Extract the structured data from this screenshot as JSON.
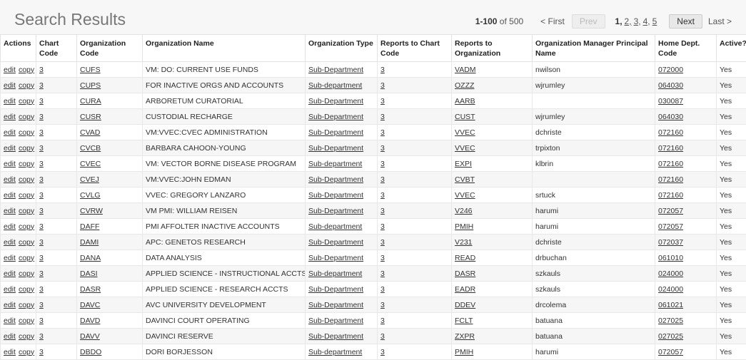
{
  "page": {
    "title": "Search Results"
  },
  "pager": {
    "range": "1-100",
    "of_total": "of 500",
    "first": "< First",
    "prev": "Prev",
    "current_page": "1,",
    "pages": [
      "2,",
      "3,",
      "4,",
      "5"
    ],
    "next": "Next",
    "last": "Last >"
  },
  "table": {
    "headers": {
      "actions": "Actions",
      "chart_code": "Chart Code",
      "org_code": "Organization Code",
      "org_name": "Organization Name",
      "org_type": "Organization Type",
      "reports_chart": "Reports to Chart Code",
      "reports_org": "Reports to Organization",
      "manager": "Organization Manager Principal Name",
      "home_dept": "Home Dept. Code",
      "active": "Active?"
    },
    "action_labels": {
      "edit": "edit",
      "copy": "copy"
    },
    "rows": [
      {
        "chart": "3",
        "code": "CUFS",
        "name": "VM: DO: CURRENT USE FUNDS",
        "type": "Sub-Department",
        "rchart": "3",
        "rorg": "VADM",
        "mgr": "nwilson",
        "dept": "072000",
        "active": "Yes"
      },
      {
        "chart": "3",
        "code": "CUPS",
        "name": "FOR INACTIVE ORGS AND ACCOUNTS",
        "type": "Sub-department",
        "rchart": "3",
        "rorg": "OZZZ",
        "mgr": "wjrumley",
        "dept": "064030",
        "active": "Yes"
      },
      {
        "chart": "3",
        "code": "CURA",
        "name": "ARBORETUM CURATORIAL",
        "type": "Sub-Department",
        "rchart": "3",
        "rorg": "AARB",
        "mgr": "",
        "dept": "030087",
        "active": "Yes"
      },
      {
        "chart": "3",
        "code": "CUSR",
        "name": "CUSTODIAL RECHARGE",
        "type": "Sub-Department",
        "rchart": "3",
        "rorg": "CUST",
        "mgr": "wjrumley",
        "dept": "064030",
        "active": "Yes"
      },
      {
        "chart": "3",
        "code": "CVAD",
        "name": "VM:VVEC:CVEC ADMINISTRATION",
        "type": "Sub-Department",
        "rchart": "3",
        "rorg": "VVEC",
        "mgr": "dchriste",
        "dept": "072160",
        "active": "Yes"
      },
      {
        "chart": "3",
        "code": "CVCB",
        "name": "BARBARA CAHOON-YOUNG",
        "type": "Sub-Department",
        "rchart": "3",
        "rorg": "VVEC",
        "mgr": "trpixton",
        "dept": "072160",
        "active": "Yes"
      },
      {
        "chart": "3",
        "code": "CVEC",
        "name": "VM: VECTOR BORNE DISEASE PROGRAM",
        "type": "Sub-department",
        "rchart": "3",
        "rorg": "EXPI",
        "mgr": "klbrin",
        "dept": "072160",
        "active": "Yes"
      },
      {
        "chart": "3",
        "code": "CVEJ",
        "name": "VM:VVEC:JOHN EDMAN",
        "type": "Sub-Department",
        "rchart": "3",
        "rorg": "CVBT",
        "mgr": "",
        "dept": "072160",
        "active": "Yes"
      },
      {
        "chart": "3",
        "code": "CVLG",
        "name": "VVEC: GREGORY LANZARO",
        "type": "Sub-Department",
        "rchart": "3",
        "rorg": "VVEC",
        "mgr": "srtuck",
        "dept": "072160",
        "active": "Yes"
      },
      {
        "chart": "3",
        "code": "CVRW",
        "name": "VM PMI: WILLIAM REISEN",
        "type": "Sub-Department",
        "rchart": "3",
        "rorg": "V246",
        "mgr": "harumi",
        "dept": "072057",
        "active": "Yes"
      },
      {
        "chart": "3",
        "code": "DAFF",
        "name": "PMI AFFOLTER INACTIVE ACCOUNTS",
        "type": "Sub-department",
        "rchart": "3",
        "rorg": "PMIH",
        "mgr": "harumi",
        "dept": "072057",
        "active": "Yes"
      },
      {
        "chart": "3",
        "code": "DAMI",
        "name": "APC: GENETOS RESEARCH",
        "type": "Sub-Department",
        "rchart": "3",
        "rorg": "V231",
        "mgr": "dchriste",
        "dept": "072037",
        "active": "Yes"
      },
      {
        "chart": "3",
        "code": "DANA",
        "name": "DATA ANALYSIS",
        "type": "Sub-Department",
        "rchart": "3",
        "rorg": "READ",
        "mgr": "drbuchan",
        "dept": "061010",
        "active": "Yes"
      },
      {
        "chart": "3",
        "code": "DASI",
        "name": "APPLIED SCIENCE - INSTRUCTIONAL ACCTS",
        "type": "Sub-department",
        "rchart": "3",
        "rorg": "DASR",
        "mgr": "szkauls",
        "dept": "024000",
        "active": "Yes"
      },
      {
        "chart": "3",
        "code": "DASR",
        "name": "APPLIED SCIENCE - RESEARCH ACCTS",
        "type": "Sub-Department",
        "rchart": "3",
        "rorg": "EADR",
        "mgr": "szkauls",
        "dept": "024000",
        "active": "Yes"
      },
      {
        "chart": "3",
        "code": "DAVC",
        "name": "AVC UNIVERSITY DEVELOPMENT",
        "type": "Sub-Department",
        "rchart": "3",
        "rorg": "DDEV",
        "mgr": "drcolema",
        "dept": "061021",
        "active": "Yes"
      },
      {
        "chart": "3",
        "code": "DAVD",
        "name": "DAVINCI COURT OPERATING",
        "type": "Sub-Department",
        "rchart": "3",
        "rorg": "FCLT",
        "mgr": "batuana",
        "dept": "027025",
        "active": "Yes"
      },
      {
        "chart": "3",
        "code": "DAVV",
        "name": "DAVINCI RESERVE",
        "type": "Sub-Department",
        "rchart": "3",
        "rorg": "ZXPR",
        "mgr": "batuana",
        "dept": "027025",
        "active": "Yes"
      },
      {
        "chart": "3",
        "code": "DBDO",
        "name": "DORI BORJESSON",
        "type": "Sub-department",
        "rchart": "3",
        "rorg": "PMIH",
        "mgr": "harumi",
        "dept": "072057",
        "active": "Yes"
      }
    ]
  }
}
